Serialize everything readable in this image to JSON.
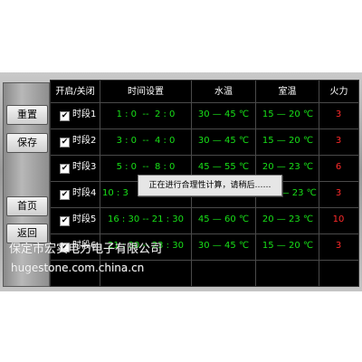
{
  "sidebar": {
    "reset_label": "重置",
    "save_label": "保存",
    "home_label": "首页",
    "back_label": "返回"
  },
  "table": {
    "columns": [
      "开启/关闭",
      "时间设置",
      "水温",
      "室温",
      "火力"
    ],
    "rows": [
      {
        "checked": true,
        "segment": "时段1",
        "time": "1 : 0  --  2 : 0",
        "water": "30 — 45 ℃",
        "room": "15 — 20 ℃",
        "fire": "3"
      },
      {
        "checked": true,
        "segment": "时段2",
        "time": "3 : 0  --  4 : 0",
        "water": "30 — 45 ℃",
        "room": "15 — 20 ℃",
        "fire": "3"
      },
      {
        "checked": true,
        "segment": "时段3",
        "time": "5 : 0  --  8 : 0",
        "water": "45 — 55 ℃",
        "room": "20 — 23 ℃",
        "fire": "6"
      },
      {
        "checked": true,
        "segment": "时段4",
        "time": "10 : 3",
        "water": "",
        "room": "0 — 23 ℃",
        "fire": "3"
      },
      {
        "checked": true,
        "segment": "时段5",
        "time": "16 : 30 -- 21 : 30",
        "water": "45 — 60 ℃",
        "room": "20 — 23 ℃",
        "fire": "10"
      },
      {
        "checked": true,
        "segment": "时段6",
        "time": "21 : 30 -- 23 : 30",
        "water": "30 — 45 ℃",
        "room": "15 — 20 ℃",
        "fire": "3"
      }
    ]
  },
  "dialog": {
    "message": "正在进行合理性计算，请稍后……"
  },
  "watermark": {
    "company": "保定市宏实电力电子有限公司",
    "url": "hugestone.com.china.cn"
  }
}
